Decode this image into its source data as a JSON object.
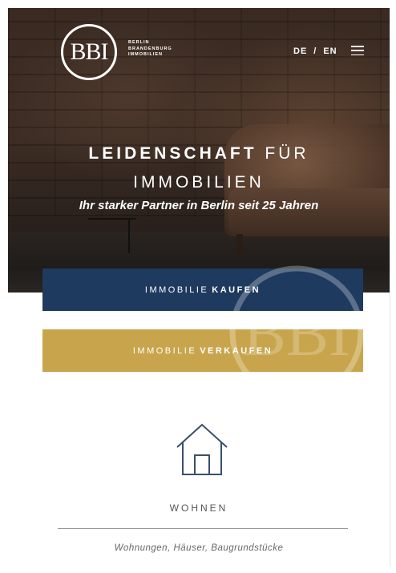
{
  "header": {
    "logo_text": "BBI",
    "logo_sub": [
      "BERLIN",
      "BRANDENBURG",
      "IMMOBILIEN"
    ],
    "lang_de": "DE",
    "lang_separator": "/",
    "lang_en": "EN",
    "menu_icon": "hamburger-menu-icon"
  },
  "hero": {
    "headline_bold": "LEIDENSCHAFT",
    "headline_rest": "FÜR",
    "headline_line2": "IMMOBILIEN",
    "tagline": "Ihr starker Partner in Berlin seit 25 Jahren"
  },
  "buttons": {
    "buy_prefix": "IMMOBILIE",
    "buy_bold": "KAUFEN",
    "sell_prefix": "IMMOBILIE",
    "sell_bold": "VERKAUFEN"
  },
  "watermark_text": "BBI",
  "service": {
    "icon": "house-icon",
    "title": "WOHNEN",
    "description": "Wohnungen, Häuser, Baugrundstücke"
  },
  "colors": {
    "navy": "#1f3a5f",
    "gold": "#c8a54c"
  }
}
